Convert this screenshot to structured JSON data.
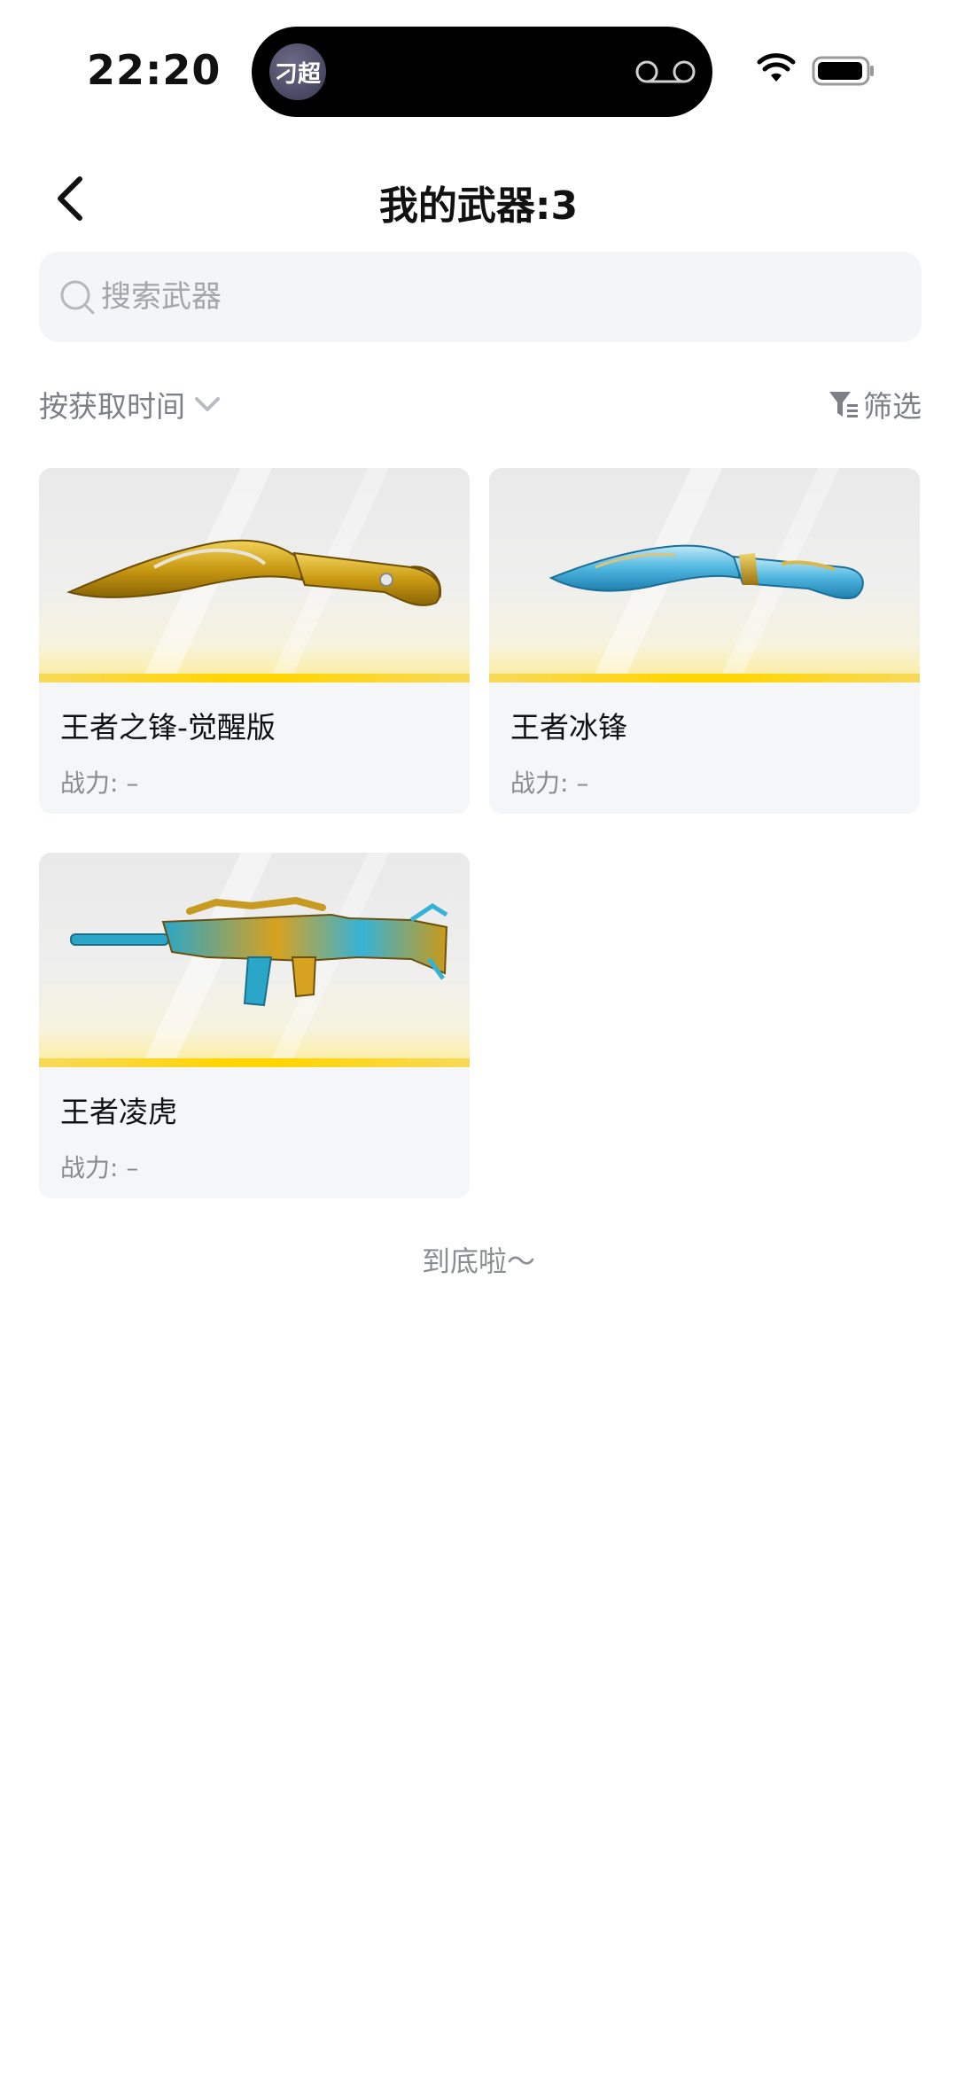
{
  "status_bar": {
    "time": "22:20",
    "island_app_label": "刁超",
    "wifi_icon": "wifi-icon",
    "battery_icon": "battery-icon"
  },
  "nav": {
    "back_icon": "chevron-left-icon",
    "title": "我的武器:3"
  },
  "search": {
    "placeholder": "搜索武器",
    "value": ""
  },
  "toolbar": {
    "sort_label": "按获取时间",
    "filter_label": "筛选"
  },
  "weapons": [
    {
      "name": "王者之锋-觉醒版",
      "power_label": "战力: –",
      "image": "golden-kukri-knife"
    },
    {
      "name": "王者冰锋",
      "power_label": "战力: –",
      "image": "ice-blue-kukri-knife"
    },
    {
      "name": "王者凌虎",
      "power_label": "战力: –",
      "image": "gold-cyan-assault-rifle"
    }
  ],
  "footer": {
    "end_text": "到底啦～"
  },
  "colors": {
    "accent_yellow": "#ffd500",
    "card_bg": "#f5f6f8",
    "search_bg": "#f4f5f7",
    "muted_text": "#7d8086"
  }
}
